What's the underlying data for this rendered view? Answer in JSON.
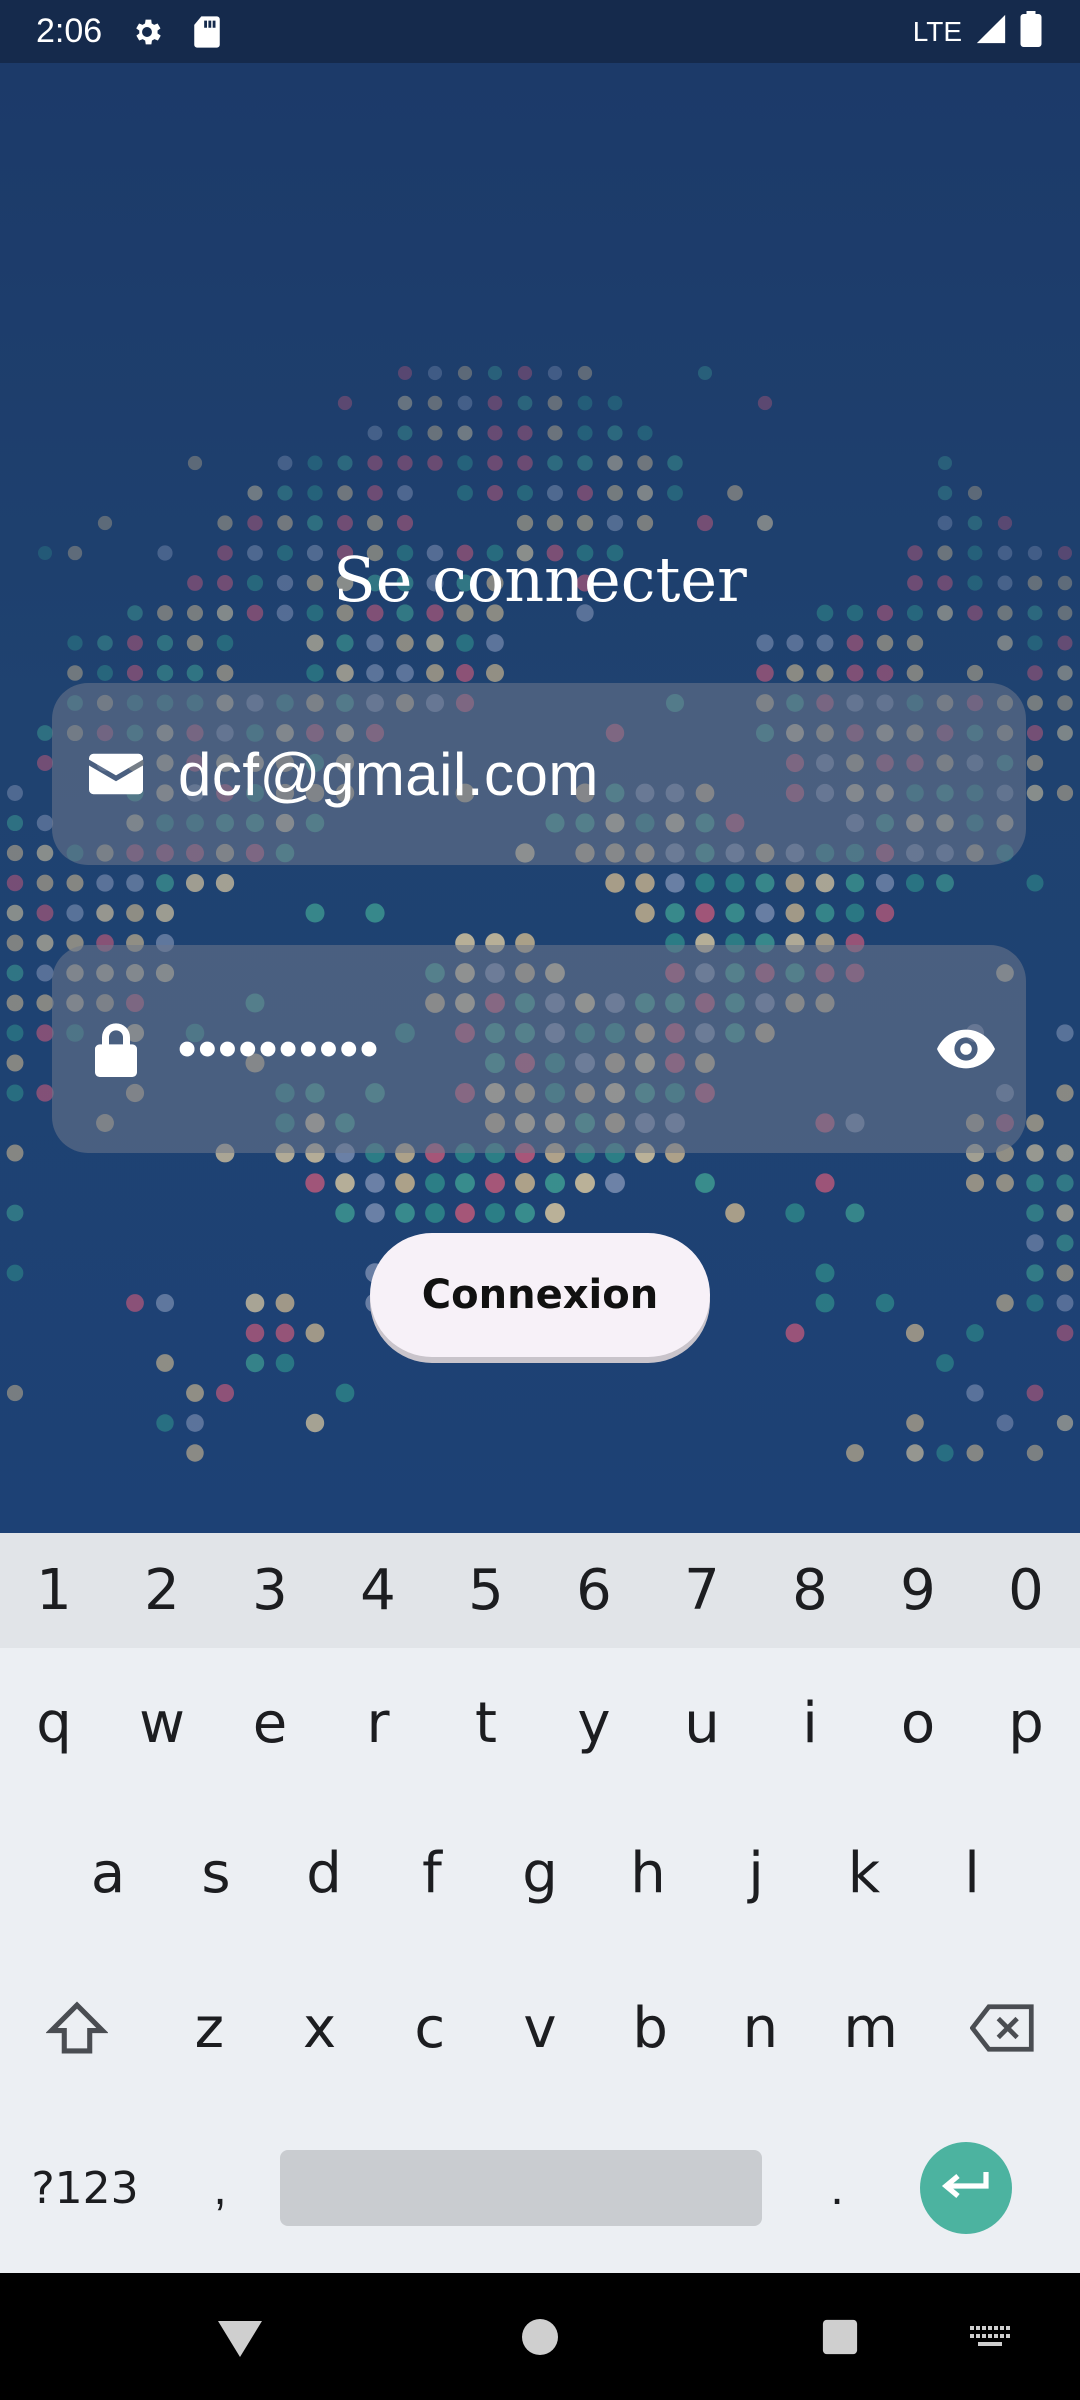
{
  "status_bar": {
    "time": "2:06",
    "network": "LTE",
    "icons": [
      "settings-icon",
      "sd-card-icon",
      "signal-icon",
      "battery-icon"
    ]
  },
  "login": {
    "title": "Se connecter",
    "email_value": "dcf@gmail.com",
    "password_value": "••••••••••",
    "button_label": "Connexion",
    "icons": [
      "envelope-icon",
      "lock-icon",
      "eye-icon"
    ]
  },
  "keyboard": {
    "number_row": [
      "1",
      "2",
      "3",
      "4",
      "5",
      "6",
      "7",
      "8",
      "9",
      "0"
    ],
    "row1": [
      "q",
      "w",
      "e",
      "r",
      "t",
      "y",
      "u",
      "i",
      "o",
      "p"
    ],
    "row2": [
      "a",
      "s",
      "d",
      "f",
      "g",
      "h",
      "j",
      "k",
      "l"
    ],
    "row3": [
      "z",
      "x",
      "c",
      "v",
      "b",
      "n",
      "m"
    ],
    "symbols_label": "?123",
    "comma": ",",
    "period": ".",
    "accent_color": "#4cb3a0"
  },
  "colors": {
    "background": "#1d3d6d",
    "field": "rgba(110,120,140,0.55)",
    "button": "#f7f1f8"
  }
}
